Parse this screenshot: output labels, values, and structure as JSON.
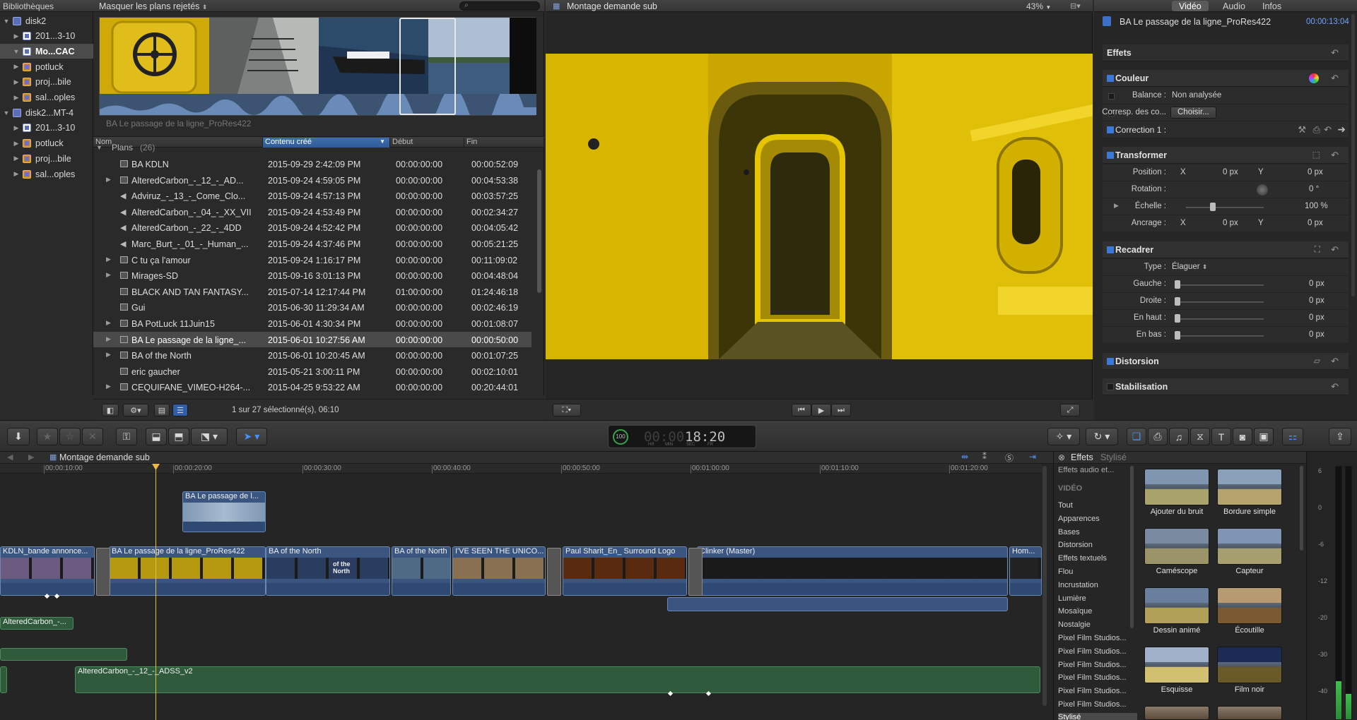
{
  "libraries": {
    "header": "Bibliothèques",
    "items": [
      {
        "label": "disk2",
        "kind": "library",
        "expanded": true,
        "indent": 0
      },
      {
        "label": "201...3-10",
        "kind": "event",
        "expanded": false,
        "indent": 1
      },
      {
        "label": "Mo...CAC",
        "kind": "event",
        "expanded": true,
        "indent": 1,
        "selected": true
      },
      {
        "label": "potluck",
        "kind": "project",
        "expanded": false,
        "indent": 1
      },
      {
        "label": "proj...bile",
        "kind": "project",
        "expanded": false,
        "indent": 1
      },
      {
        "label": "sal...oples",
        "kind": "project",
        "expanded": false,
        "indent": 1
      },
      {
        "label": "disk2...MT-4",
        "kind": "library",
        "expanded": true,
        "indent": 0
      },
      {
        "label": "201...3-10",
        "kind": "event",
        "expanded": false,
        "indent": 1
      },
      {
        "label": "potluck",
        "kind": "project",
        "expanded": false,
        "indent": 1
      },
      {
        "label": "proj...bile",
        "kind": "project",
        "expanded": false,
        "indent": 1
      },
      {
        "label": "sal...oples",
        "kind": "project",
        "expanded": false,
        "indent": 1
      }
    ]
  },
  "browser": {
    "filter_label": "Masquer les plans rejetés",
    "clip_caption": "BA Le passage de la ligne_ProRes422",
    "columns": {
      "name": "Nom",
      "created": "Contenu créé",
      "start": "Début",
      "end": "Fin"
    },
    "group": {
      "label": "Plans",
      "count": "(26)"
    },
    "rows": [
      {
        "name": "BA KDLN",
        "created": "2015-09-29 2:42:09 PM",
        "start": "00:00:00:00",
        "end": "00:00:52:09",
        "expandable": false,
        "type": "clip"
      },
      {
        "name": "AlteredCarbon_-_12_-_AD...",
        "created": "2015-09-24 4:59:05 PM",
        "start": "00:00:00:00",
        "end": "00:04:53:38",
        "expandable": true,
        "type": "clip"
      },
      {
        "name": "Adviruz_-_13_-_Come_Clo...",
        "created": "2015-09-24 4:57:13 PM",
        "start": "00:00:00:00",
        "end": "00:03:57:25",
        "expandable": false,
        "type": "audio"
      },
      {
        "name": "AlteredCarbon_-_04_-_XX_VII",
        "created": "2015-09-24 4:53:49 PM",
        "start": "00:00:00:00",
        "end": "00:02:34:27",
        "expandable": false,
        "type": "audio"
      },
      {
        "name": "AlteredCarbon_-_22_-_4DD",
        "created": "2015-09-24 4:52:42 PM",
        "start": "00:00:00:00",
        "end": "00:04:05:42",
        "expandable": false,
        "type": "audio"
      },
      {
        "name": "Marc_Burt_-_01_-_Human_...",
        "created": "2015-09-24 4:37:46 PM",
        "start": "00:00:00:00",
        "end": "00:05:21:25",
        "expandable": false,
        "type": "audio"
      },
      {
        "name": "C tu ça l'amour",
        "created": "2015-09-24 1:16:17 PM",
        "start": "00:00:00:00",
        "end": "00:11:09:02",
        "expandable": true,
        "type": "clip"
      },
      {
        "name": "Mirages-SD",
        "created": "2015-09-16 3:01:13 PM",
        "start": "00:00:00:00",
        "end": "00:04:48:04",
        "expandable": true,
        "type": "clip"
      },
      {
        "name": "BLACK AND TAN FANTASY...",
        "created": "2015-07-14 12:17:44 PM",
        "start": "01:00:00:00",
        "end": "01:24:46:18",
        "expandable": false,
        "type": "clip"
      },
      {
        "name": "Gui",
        "created": "2015-06-30 11:29:34 AM",
        "start": "00:00:00:00",
        "end": "00:02:46:19",
        "expandable": false,
        "type": "clip"
      },
      {
        "name": "BA PotLuck 11Juin15",
        "created": "2015-06-01 4:30:34 PM",
        "start": "00:00:00:00",
        "end": "00:01:08:07",
        "expandable": true,
        "type": "clip"
      },
      {
        "name": "BA Le passage de la ligne_...",
        "created": "2015-06-01 10:27:56 AM",
        "start": "00:00:00:00",
        "end": "00:00:50:00",
        "expandable": true,
        "type": "clip",
        "selected": true
      },
      {
        "name": "BA of the North",
        "created": "2015-06-01 10:20:45 AM",
        "start": "00:00:00:00",
        "end": "00:01:07:25",
        "expandable": true,
        "type": "clip"
      },
      {
        "name": "eric gaucher",
        "created": "2015-05-21 3:00:11 PM",
        "start": "00:00:00:00",
        "end": "00:02:10:01",
        "expandable": false,
        "type": "clip"
      },
      {
        "name": "CEQUIFANE_VIMEO-H264-...",
        "created": "2015-04-25 9:53:22 AM",
        "start": "00:00:00:00",
        "end": "00:20:44:01",
        "expandable": true,
        "type": "clip"
      }
    ],
    "selection_status": "1 sur 27 sélectionné(s), 06:10"
  },
  "viewer": {
    "title": "Montage demande sub",
    "zoom": "43%"
  },
  "inspector": {
    "tabs": [
      "Vidéo",
      "Audio",
      "Infos"
    ],
    "active_tab": "Vidéo",
    "clip_name": "BA Le passage de la ligne_ProRes422",
    "duration": "00:00:13:04",
    "effects_header": "Effets",
    "color": {
      "title": "Couleur",
      "balance_label": "Balance :",
      "balance_value": "Non analysée",
      "match_label": "Corresp. des co...",
      "match_button": "Choisir...",
      "correction_label": "Correction 1 :"
    },
    "transform": {
      "title": "Transformer",
      "position_label": "Position :",
      "position_x_label": "X",
      "position_x": "0 px",
      "position_y_label": "Y",
      "position_y": "0 px",
      "rotation_label": "Rotation :",
      "rotation": "0 °",
      "scale_label": "Échelle :",
      "scale": "100 %",
      "anchor_label": "Ancrage :",
      "anchor_x_label": "X",
      "anchor_x": "0 px",
      "anchor_y_label": "Y",
      "anchor_y": "0 px"
    },
    "crop": {
      "title": "Recadrer",
      "type_label": "Type :",
      "type_value": "Élaguer",
      "left_label": "Gauche :",
      "left": "0 px",
      "right_label": "Droite :",
      "right": "0 px",
      "top_label": "En haut :",
      "top": "0 px",
      "bottom_label": "En bas :",
      "bottom": "0 px"
    },
    "distortion": {
      "title": "Distorsion"
    },
    "stabilization": {
      "title": "Stabilisation"
    }
  },
  "toolbar": {
    "timecode": "18:20",
    "timecode_ghost": "00:00",
    "timecode_percent": "100",
    "timecode_units": [
      "HR",
      "MIN",
      "SEC",
      "FR"
    ]
  },
  "timeline": {
    "title": "Montage demande sub",
    "ruler": [
      "00:00:10:00",
      "00:00:20:00",
      "00:00:30:00",
      "00:00:40:00",
      "00:00:50:00",
      "00:01:00:00",
      "00:01:10:00",
      "00:01:20:00"
    ],
    "connected_clip": "BA Le passage de l...",
    "primary_clips": [
      "KDLN_bande annonce...",
      "BA Le passage de la ligne_ProRes422",
      "BA of the North",
      "BA of the North",
      "I'VE SEEN THE UNICO...",
      "Paul Sharit_En_ Surround Logo",
      "Clinker (Master)",
      "Hom..."
    ],
    "thumb_overlay_text": "of the North",
    "audio_clips": [
      "AlteredCarbon_-...",
      "AlteredCarbon_-_12_-_ADSS_v2"
    ]
  },
  "effects_browser": {
    "title": "Effets",
    "subtitle": "Stylisé",
    "categories_top": "Effets audio et...",
    "video_header": "VIDÉO",
    "categories": [
      "Tout",
      "Apparences",
      "Bases",
      "Distorsion",
      "Effets textuels",
      "Flou",
      "Incrustation",
      "Lumière",
      "Mosaïque",
      "Nostalgie",
      "Pixel Film Studios...",
      "Pixel Film Studios...",
      "Pixel Film Studios...",
      "Pixel Film Studios...",
      "Pixel Film Studios...",
      "Pixel Film Studios..."
    ],
    "selected_category": "Stylisé",
    "tiles": [
      "Ajouter du bruit",
      "Bordure simple",
      "Caméscope",
      "Capteur",
      "Dessin animé",
      "Écoutille",
      "Esquisse",
      "Film noir"
    ]
  },
  "audio_meters": {
    "db_labels": [
      "6",
      "0",
      "-6",
      "-12",
      "-20",
      "-30",
      "-40"
    ],
    "levels": [
      0.15,
      0.1
    ]
  }
}
